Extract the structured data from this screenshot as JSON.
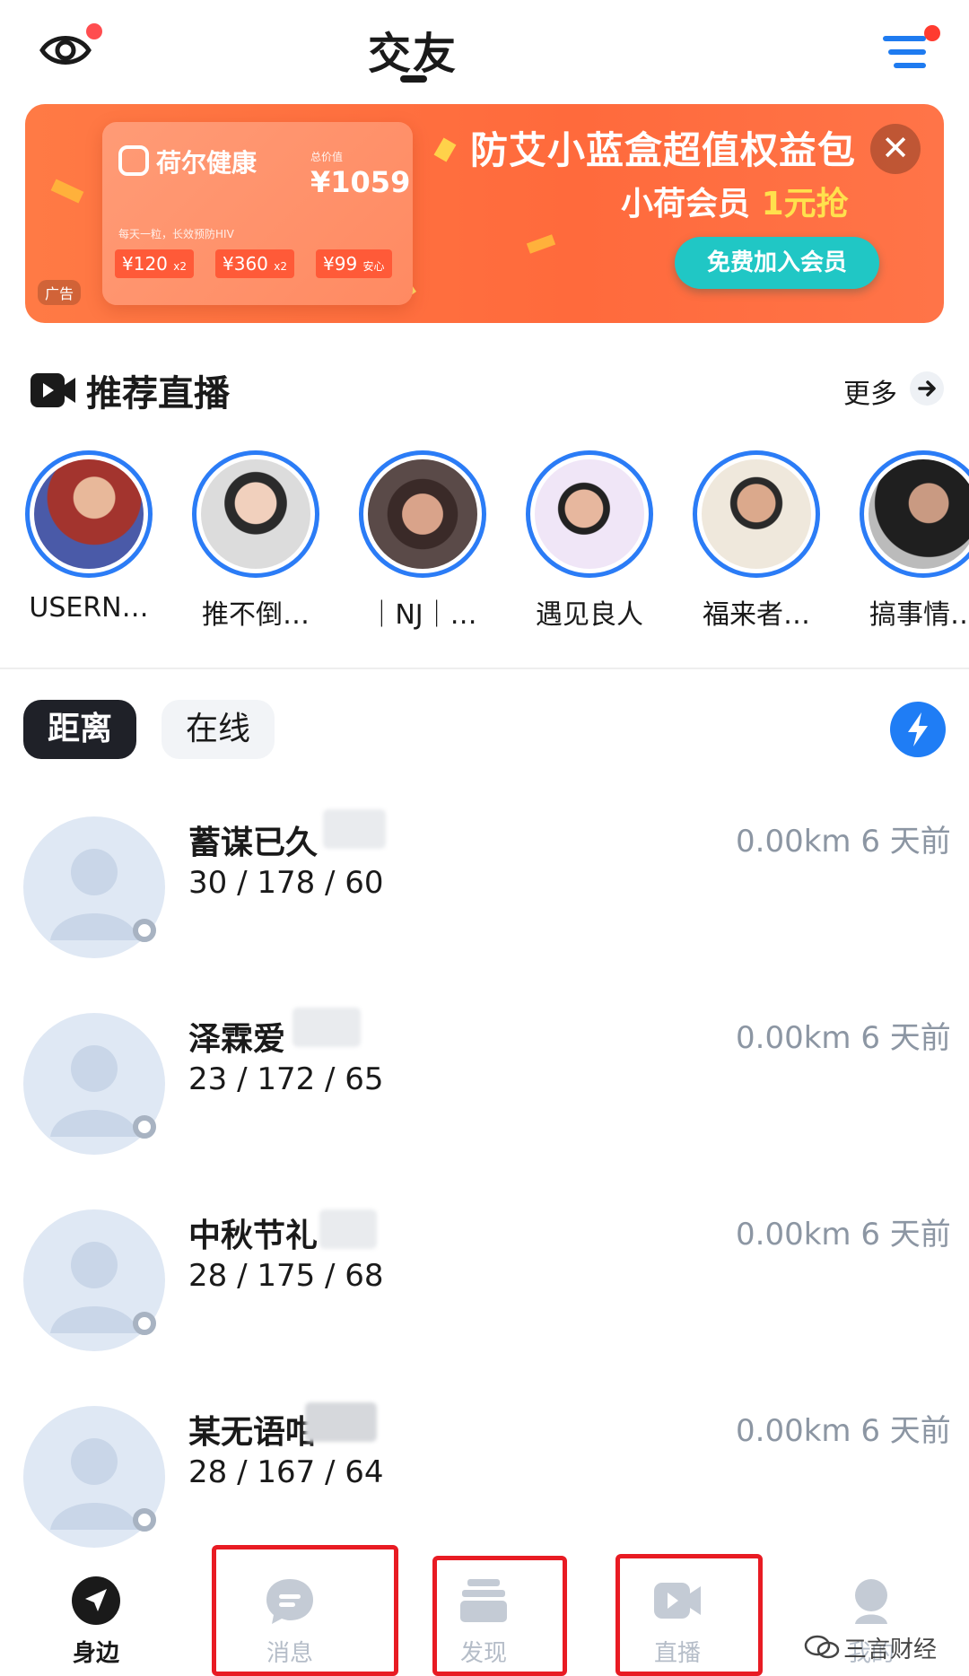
{
  "header": {
    "title": "交友"
  },
  "banner": {
    "brand": "荷尔健康",
    "price_label": "总价值",
    "price": "¥1059",
    "card_sub": "每天一粒，长效预防HIV",
    "coupons": [
      {
        "amount": "¥120",
        "mult": "x2"
      },
      {
        "amount": "¥360",
        "mult": "x2"
      },
      {
        "amount": "¥99",
        "mult": "安心"
      }
    ],
    "ad_tag": "广告",
    "title": "防艾小蓝盒超值权益包",
    "sub_prefix": "小荷会员",
    "sub_highlight": "1元抢",
    "button": "免费加入会员",
    "close": "✕"
  },
  "live": {
    "title": "推荐直播",
    "more": "更多",
    "items": [
      {
        "name": "USERN…"
      },
      {
        "name": "推不倒…"
      },
      {
        "name": "｜NJ｜…"
      },
      {
        "name": "遇见良人"
      },
      {
        "name": "福来者…"
      },
      {
        "name": "搞事情…"
      }
    ]
  },
  "tabs": {
    "distance": "距离",
    "online": "在线"
  },
  "users": [
    {
      "name": "蓄谋已久",
      "stats": "30 / 178 / 60",
      "meta": "0.00km 6 天前"
    },
    {
      "name": "泽霖爱",
      "stats": "23 / 172 / 65",
      "meta": "0.00km 6 天前"
    },
    {
      "name": "中秋节礼",
      "stats": "28 / 175 / 68",
      "meta": "0.00km 6 天前"
    },
    {
      "name": "某无语咁",
      "stats": "28 / 167 / 64",
      "meta": "0.00km 6 天前"
    }
  ],
  "nav": {
    "nearby": "身边",
    "messages": "消息",
    "discover": "发现",
    "live": "直播",
    "mine": "我的"
  },
  "watermark": "三言财经",
  "colors": {
    "accent": "#1f7df5",
    "banner": "#ff6a3c",
    "annotation_box": "#e81b23"
  }
}
